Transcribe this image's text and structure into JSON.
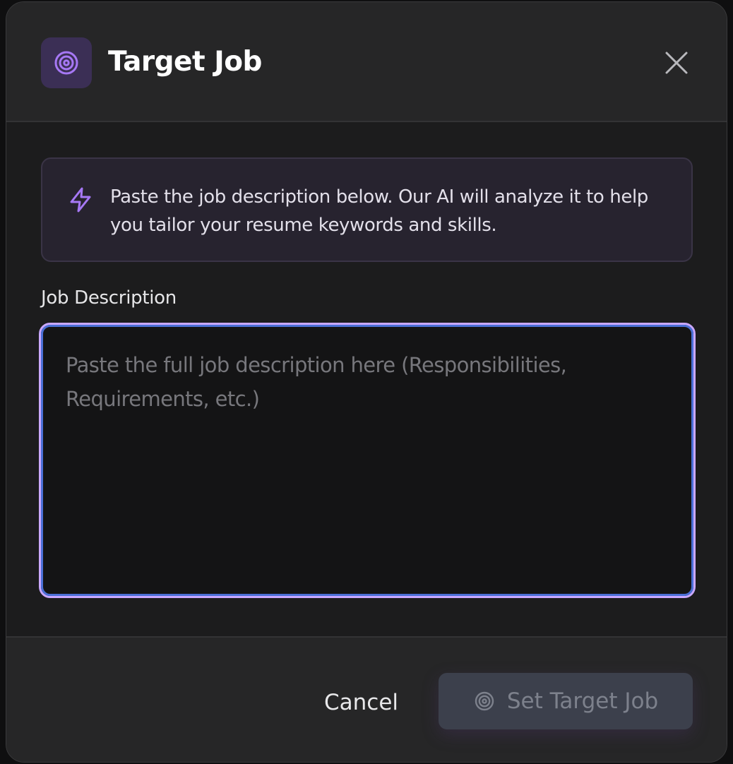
{
  "dialog": {
    "title": "Target Job",
    "header_icon": "target-icon",
    "close_icon": "close-icon"
  },
  "info": {
    "icon": "lightning-icon",
    "text": "Paste the job description below. Our AI will analyze it to help you tailor your resume keywords and skills."
  },
  "form": {
    "label": "Job Description",
    "value": "",
    "placeholder": "Paste the full job description here (Responsibilities, Requirements, etc.)"
  },
  "footer": {
    "cancel_label": "Cancel",
    "submit_label": "Set Target Job",
    "submit_icon": "target-icon",
    "submit_disabled": true
  },
  "colors": {
    "accent": "#a678f5",
    "focus_ring": "#4b6fd6",
    "disabled_button": "#3c404c"
  }
}
